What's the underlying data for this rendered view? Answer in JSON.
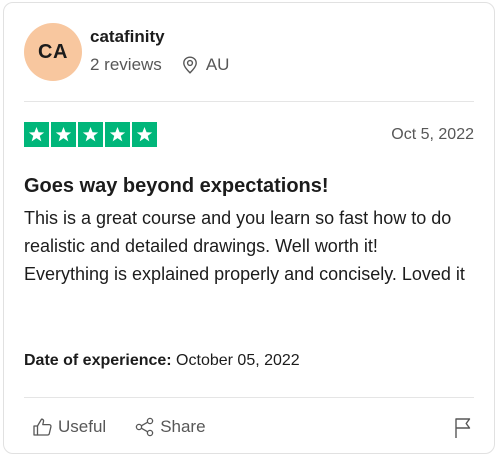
{
  "reviewer": {
    "initials": "CA",
    "name": "catafinity",
    "reviews_count": "2 reviews",
    "location": "AU",
    "avatar_color": "#f8c79f"
  },
  "review": {
    "rating": 5,
    "rating_color": "#00b67a",
    "date": "Oct 5, 2022",
    "title": "Goes way beyond expectations!",
    "paragraphs": [
      "This is a great course and you learn so fast how to do realistic and detailed drawings. Well worth it!",
      "Everything is explained properly and concisely. Loved it"
    ],
    "experience_label": "Date of experience:",
    "experience_date": " October 05, 2022"
  },
  "actions": {
    "useful_label": "Useful",
    "useful_icon": "thumbs-up-icon",
    "share_label": "Share",
    "share_icon": "share-icon",
    "report_icon": "flag-icon"
  },
  "icons": {
    "location": "location-pin-icon",
    "star": "star-icon"
  }
}
